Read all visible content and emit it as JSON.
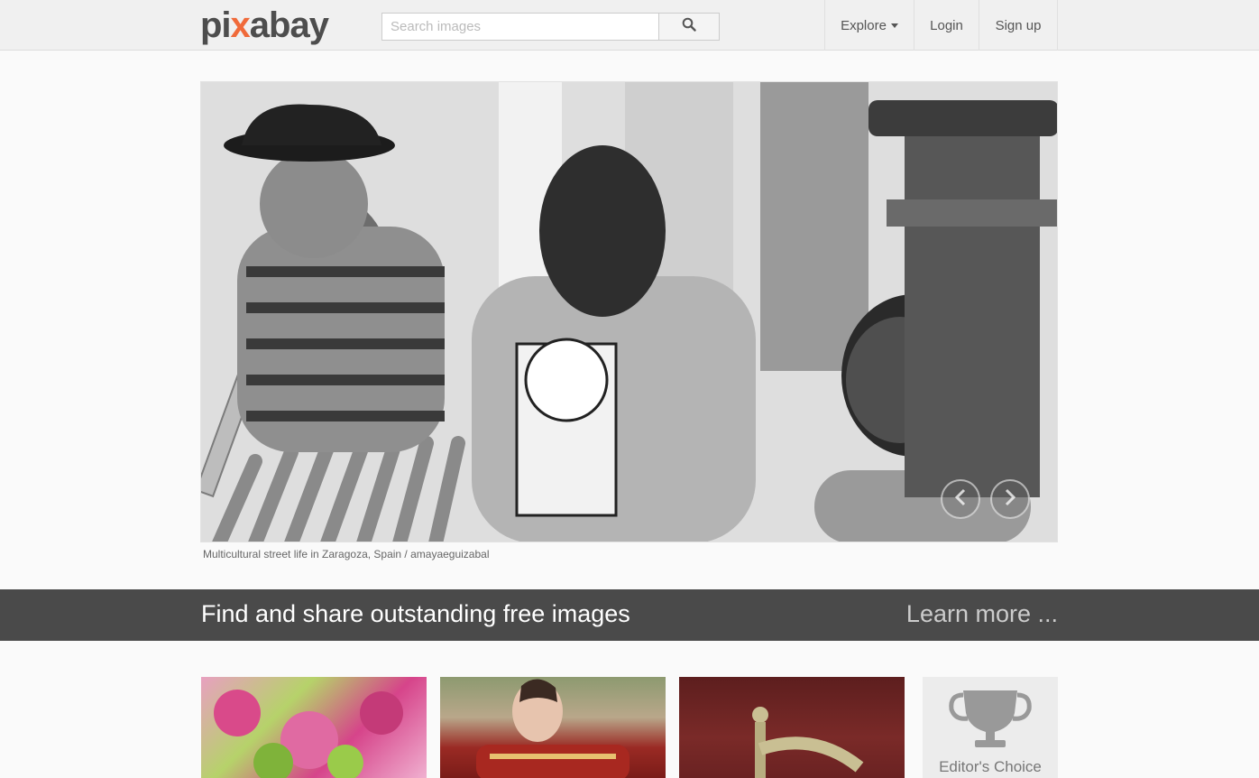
{
  "header": {
    "logo_text_a": "pi",
    "logo_text_x": "x",
    "logo_text_b": "abay",
    "search": {
      "placeholder": "Search images",
      "value": ""
    },
    "nav": {
      "explore": "Explore",
      "login": "Login",
      "signup": "Sign up"
    }
  },
  "hero": {
    "caption": "Multicultural street life in Zaragoza, Spain  / amayaeguizabal"
  },
  "banner": {
    "title": "Find and share outstanding free images",
    "more": "Learn more ..."
  },
  "featured": {
    "editors_choice": "Editor's Choice"
  },
  "colors": {
    "logo_accent": "#f06a3a",
    "banner_bg": "#4a4a4a",
    "topbar_bg": "#f0f0f0"
  }
}
